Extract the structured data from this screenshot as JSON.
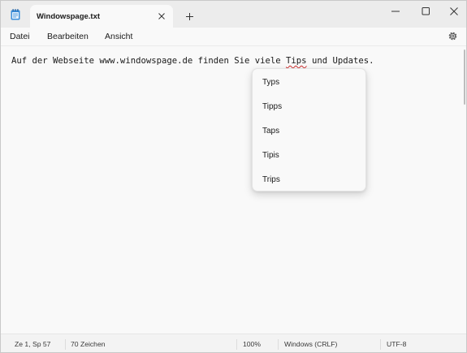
{
  "window": {
    "tab_title": "Windowspage.txt"
  },
  "menu": {
    "datei": "Datei",
    "bearbeiten": "Bearbeiten",
    "ansicht": "Ansicht"
  },
  "editor": {
    "text_before": "Auf der Webseite www.windowspage.de finden Sie viele ",
    "misspelled_word": "Tips",
    "text_after": " und Updates."
  },
  "context_menu": {
    "suggestions": [
      "Typs",
      "Tipps",
      "Taps",
      "Tipis",
      "Trips"
    ]
  },
  "statusbar": {
    "position": "Ze 1, Sp 57",
    "characters": "70 Zeichen",
    "zoom": "100%",
    "line_endings": "Windows (CRLF)",
    "encoding": "UTF-8"
  },
  "icons": {
    "app": "notepad-icon",
    "tab_close": "close-icon",
    "new_tab": "plus-icon",
    "minimize": "minimize-icon",
    "maximize": "maximize-icon",
    "close": "close-icon",
    "settings": "gear-icon"
  },
  "colors": {
    "accent": "#1e88e5",
    "spellcheck_underline": "#d03030"
  }
}
